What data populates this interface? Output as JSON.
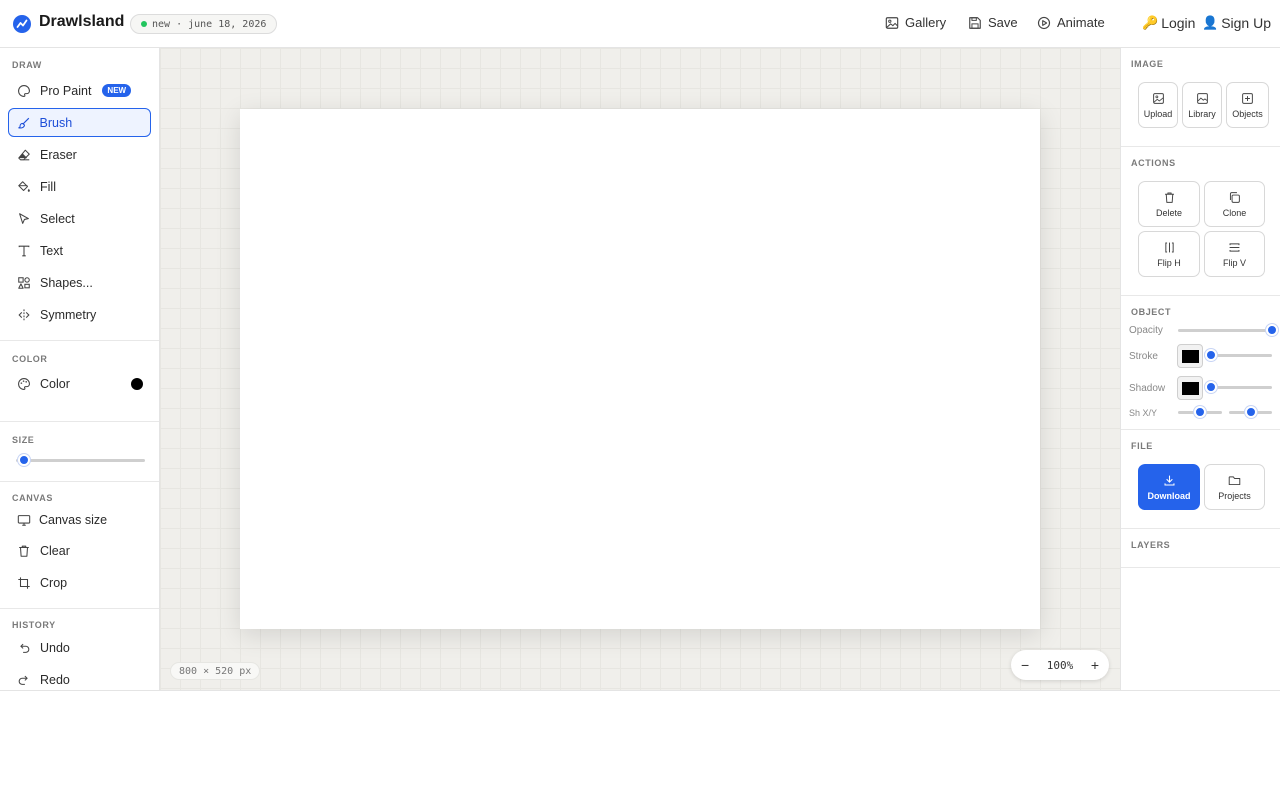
{
  "header": {
    "brand": "Drawlsland",
    "status": "new · june 18, 2026",
    "nav": {
      "gallery": "Gallery",
      "save": "Save",
      "animate": "Animate",
      "login": "Login",
      "signup": "Sign Up"
    }
  },
  "left": {
    "draw_title": "DRAW",
    "tools": [
      {
        "label": "Pro Paint",
        "icon": "palette-icon",
        "badge": "NEW"
      },
      {
        "label": "Brush",
        "icon": "brush-icon",
        "active": true
      },
      {
        "label": "Eraser",
        "icon": "eraser-icon"
      },
      {
        "label": "Fill",
        "icon": "paint-bucket-icon"
      },
      {
        "label": "Select",
        "icon": "cursor-icon"
      },
      {
        "label": "Text",
        "icon": "text-icon"
      },
      {
        "label": "Shapes...",
        "icon": "shapes-icon"
      },
      {
        "label": "Symmetry",
        "icon": "symmetry-icon"
      }
    ],
    "color_title": "COLOR",
    "color_label": "Color",
    "color_value": "#000000",
    "size_title": "SIZE",
    "size_value": 0.06,
    "canvas_title": "CANVAS",
    "canvas_items": [
      {
        "label": "Canvas size",
        "icon": "monitor-icon"
      },
      {
        "label": "Clear",
        "icon": "trash-icon"
      },
      {
        "label": "Crop",
        "icon": "crop-icon"
      }
    ],
    "history_title": "HISTORY",
    "history_items": [
      {
        "label": "Undo",
        "icon": "undo-icon"
      },
      {
        "label": "Redo",
        "icon": "redo-icon"
      }
    ]
  },
  "stage": {
    "canvas_size": "800 × 520 px",
    "zoom": "100%",
    "zoom_out": "−",
    "zoom_in": "+"
  },
  "right": {
    "image_title": "IMAGE",
    "image_buttons": [
      "Upload",
      "Library",
      "Objects"
    ],
    "actions_title": "ACTIONS",
    "action_buttons": [
      "Delete",
      "Clone",
      "Flip H",
      "Flip V"
    ],
    "object_title": "OBJECT",
    "opacity_label": "Opacity",
    "opacity_value": 1.0,
    "stroke_label": "Stroke",
    "stroke_color": "#000000",
    "stroke_value": 0.0,
    "shadow_label": "Shadow",
    "shadow_color": "#000000",
    "shadow_value": 0.0,
    "shxy_label": "Sh X/Y",
    "sh_x_value": 0.5,
    "sh_y_value": 0.5,
    "file_title": "FILE",
    "file_buttons": [
      "Download",
      "Projects"
    ],
    "layers_title": "LAYERS"
  },
  "colors": {
    "accent": "#2563eb",
    "status_dot": "#22c55e"
  }
}
